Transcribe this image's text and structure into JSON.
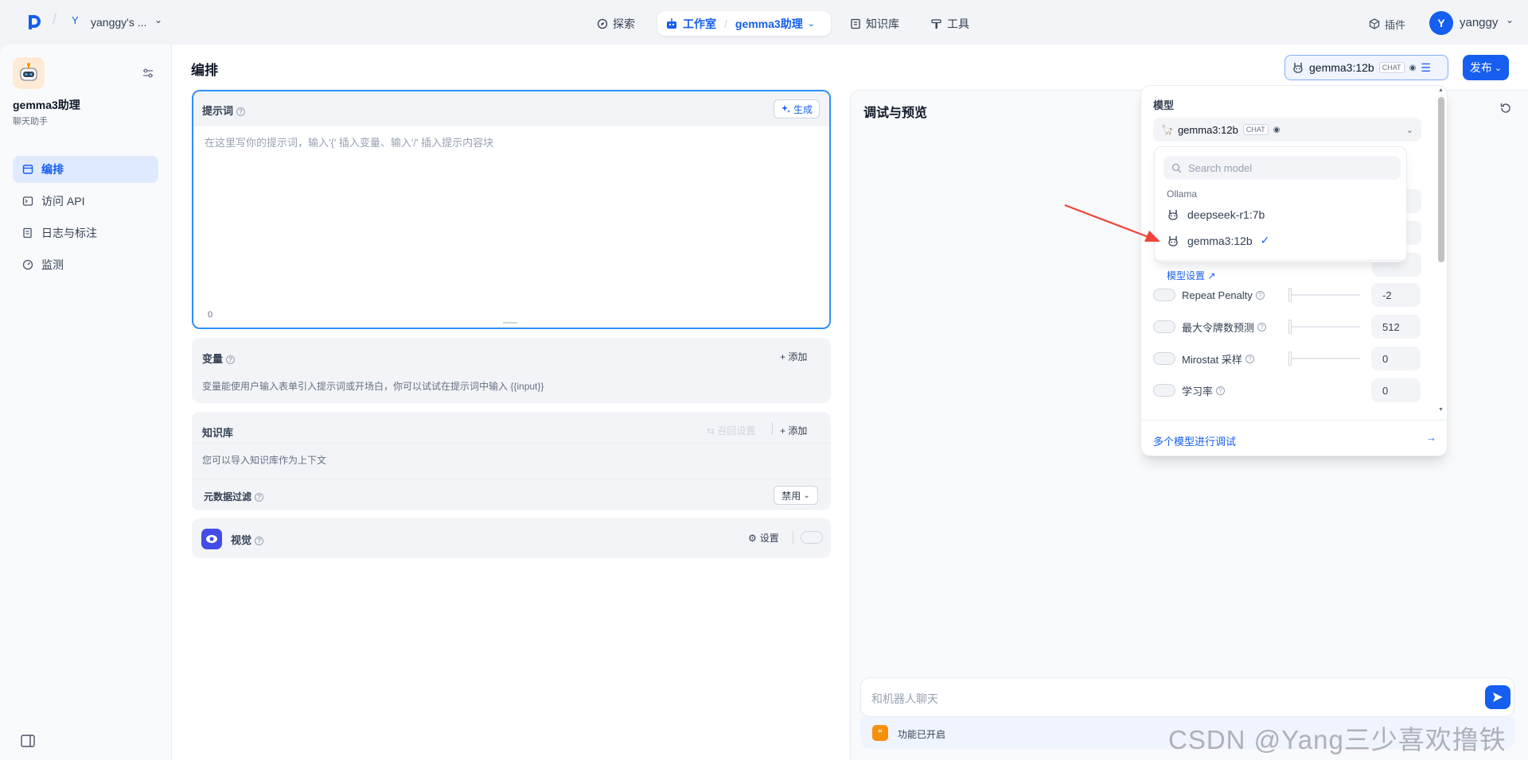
{
  "header": {
    "workspace_initial": "Y",
    "workspace_name": "yanggy's ...",
    "nav": {
      "explore": "探索",
      "studio": "工作室",
      "app_name": "gemma3助理",
      "knowledge": "知识库",
      "tools": "工具"
    },
    "plugins": "插件",
    "user_initial": "Y",
    "user_name": "yanggy"
  },
  "sidebar": {
    "app_name": "gemma3助理",
    "app_desc": "聊天助手",
    "items": [
      {
        "label": "编排",
        "icon": "layout-icon",
        "active": true
      },
      {
        "label": "访问 API",
        "icon": "terminal-icon",
        "active": false
      },
      {
        "label": "日志与标注",
        "icon": "log-icon",
        "active": false
      },
      {
        "label": "监测",
        "icon": "gauge-icon",
        "active": false
      }
    ]
  },
  "main": {
    "title": "编排",
    "prompt": {
      "title": "提示词",
      "generate_label": "生成",
      "placeholder": "在这里写你的提示词，输入'{' 插入变量、输入'/' 插入提示内容块",
      "char_count": "0"
    },
    "variables": {
      "title": "变量",
      "add_label": "添加",
      "desc": "变量能使用户输入表单引入提示词或开场白，你可以试试在提示词中输入 {{input}}"
    },
    "knowledge": {
      "title": "知识库",
      "recall_label": "召回设置",
      "add_label": "添加",
      "desc": "您可以导入知识库作为上下文",
      "metadata_filter": "元数据过滤",
      "filter_value": "禁用"
    },
    "vision": {
      "title": "视觉",
      "settings_label": "设置",
      "enabled": false
    }
  },
  "debug": {
    "title": "调试与预览",
    "chat_placeholder": "和机器人聊天",
    "feature_status": "功能已开启"
  },
  "toolbar": {
    "model_name": "gemma3:12b",
    "model_tag": "CHAT",
    "publish_label": "发布"
  },
  "popover": {
    "section_label": "模型",
    "selected_model": "gemma3:12b",
    "selected_tag": "CHAT",
    "search_placeholder": "Search model",
    "provider": "Ollama",
    "models": [
      {
        "name": "deepseek-r1:7b",
        "selected": false
      },
      {
        "name": "gemma3:12b",
        "selected": true
      }
    ],
    "model_settings_link": "模型设置 ↗",
    "params": [
      {
        "label": "Repeat Penalty",
        "value": "-2",
        "enabled": false
      },
      {
        "label": "最大令牌数预测",
        "value": "512",
        "enabled": false
      },
      {
        "label": "Mirostat 采样",
        "value": "0",
        "enabled": false
      },
      {
        "label": "学习率",
        "value": "0",
        "enabled": false
      }
    ],
    "multi_model_debug": "多个模型进行调试"
  },
  "watermark": "CSDN @Yang三少喜欢撸铁",
  "colors": {
    "accent": "#155eef",
    "focus_border": "#2e90fa",
    "annotation_arrow": "#f04438"
  }
}
